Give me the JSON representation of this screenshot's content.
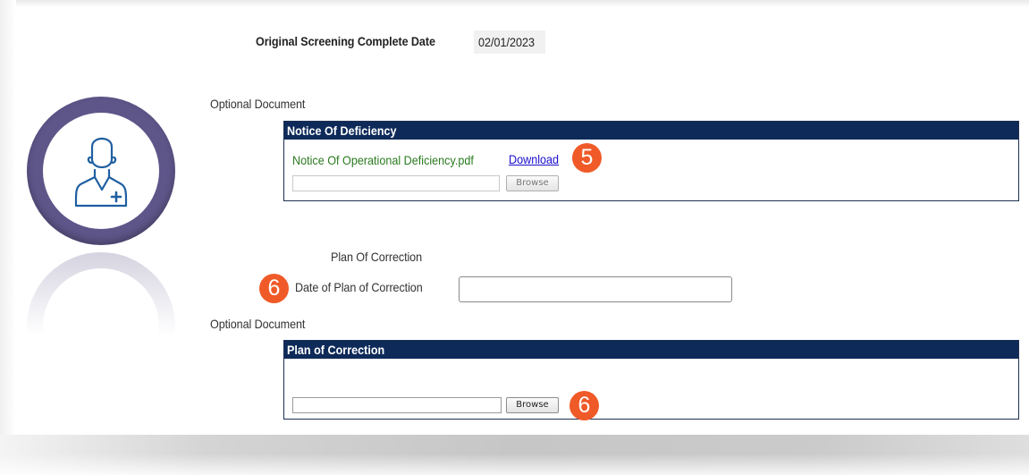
{
  "screening": {
    "label": "Original Screening Complete Date",
    "date": "02/01/2023"
  },
  "notice_section": {
    "optional_label": "Optional Document",
    "panel_title": "Notice Of Deficiency",
    "file_name": "Notice Of Operational Deficiency.pdf",
    "download_label": "Download",
    "browse_label": "Browse",
    "marker": "5"
  },
  "plan_section": {
    "heading": "Plan Of Correction",
    "date_label": "Date of Plan of Correction",
    "date_value": "",
    "date_marker": "6",
    "optional_label": "Optional Document",
    "panel_title": "Plan of Correction",
    "browse_label": "Browse",
    "browse_marker": "6"
  },
  "icons": {
    "avatar": "user-plus-icon"
  },
  "colors": {
    "panel_header": "#0e2a59",
    "marker": "#f05a28",
    "file_link": "#2a7a1f",
    "download_link": "#1a0dcc",
    "avatar_ring": "#5e5689"
  }
}
